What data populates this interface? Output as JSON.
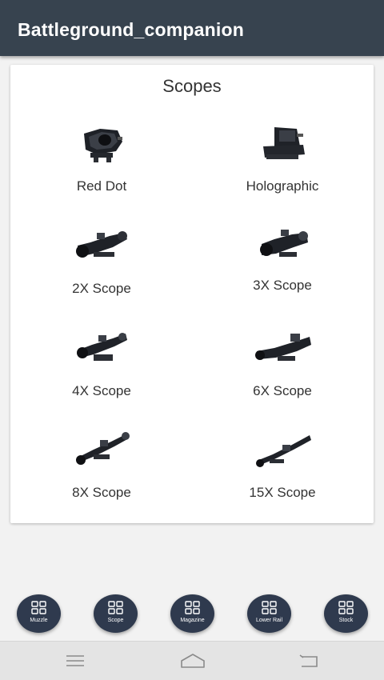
{
  "app": {
    "title": "Battleground_companion"
  },
  "card": {
    "title": "Scopes"
  },
  "scopes": [
    {
      "label": "Red Dot",
      "icon": "red-dot-sight-icon"
    },
    {
      "label": "Holographic",
      "icon": "holographic-sight-icon"
    },
    {
      "label": "2X Scope",
      "icon": "2x-scope-icon"
    },
    {
      "label": "3X Scope",
      "icon": "3x-scope-icon"
    },
    {
      "label": "4X Scope",
      "icon": "4x-scope-icon"
    },
    {
      "label": "6X Scope",
      "icon": "6x-scope-icon"
    },
    {
      "label": "8X Scope",
      "icon": "8x-scope-icon"
    },
    {
      "label": "15X Scope",
      "icon": "15x-scope-icon"
    }
  ],
  "bottom_tabs": [
    {
      "label": "Muzzle",
      "icon": "grid-icon"
    },
    {
      "label": "Scope",
      "icon": "grid-icon"
    },
    {
      "label": "Magazine",
      "icon": "grid-icon"
    },
    {
      "label": "Lower Rail",
      "icon": "grid-icon"
    },
    {
      "label": "Stock",
      "icon": "grid-icon"
    }
  ],
  "colors": {
    "app_bar": "#37434f",
    "tab_button": "#2f3a4e",
    "card": "#ffffff",
    "background": "#f2f2f2"
  }
}
